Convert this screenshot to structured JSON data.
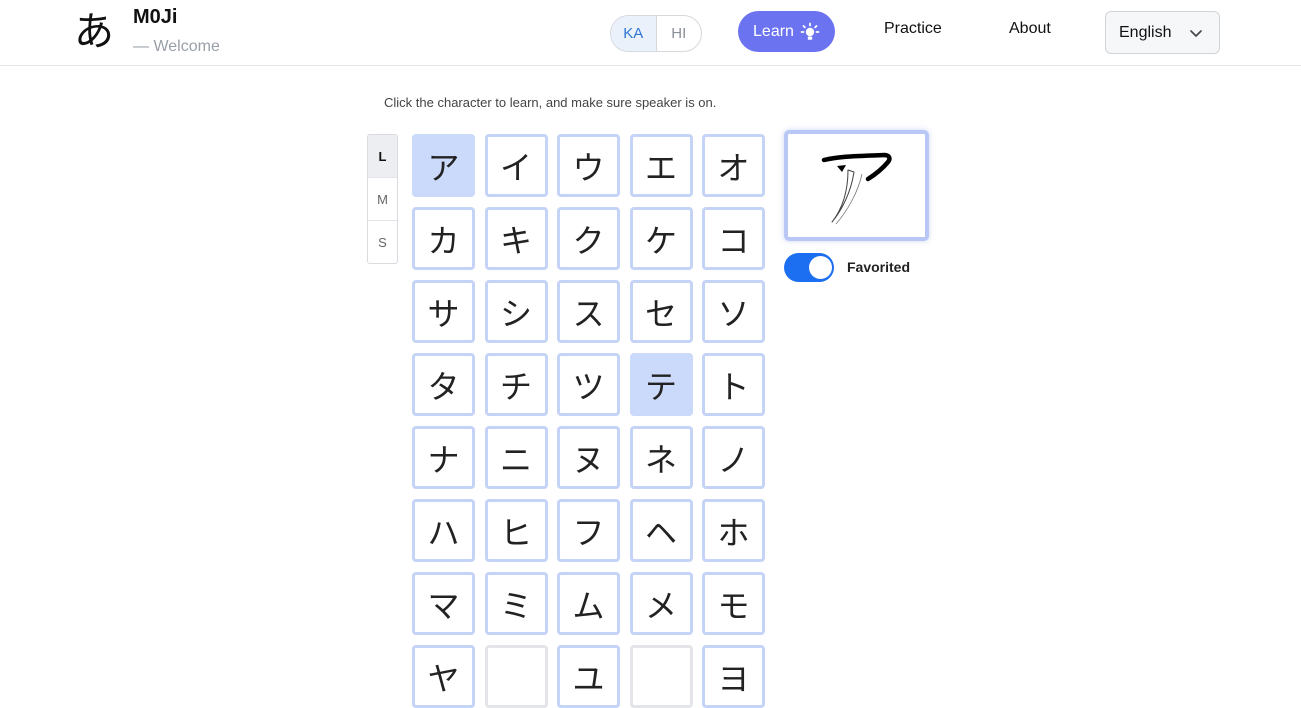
{
  "header": {
    "logo_glyph": "あ",
    "app_title": "M0Ji",
    "subtitle": "— Welcome",
    "script_toggle": [
      {
        "label": "KA",
        "active": true
      },
      {
        "label": "HI",
        "active": false
      }
    ],
    "nav": {
      "learn_label": "Learn",
      "practice_label": "Practice",
      "about_label": "About"
    },
    "language": {
      "selected": "English"
    }
  },
  "main": {
    "hint": "Click the character to learn, and make sure speaker is on.",
    "size_tabs": [
      {
        "label": "L",
        "active": true
      },
      {
        "label": "M",
        "active": false
      },
      {
        "label": "S",
        "active": false
      }
    ],
    "characters": [
      "ア",
      "イ",
      "ウ",
      "エ",
      "オ",
      "カ",
      "キ",
      "ク",
      "ケ",
      "コ",
      "サ",
      "シ",
      "ス",
      "セ",
      "ソ",
      "タ",
      "チ",
      "ツ",
      "テ",
      "ト",
      "ナ",
      "ニ",
      "ヌ",
      "ネ",
      "ノ",
      "ハ",
      "ヒ",
      "フ",
      "ヘ",
      "ホ",
      "マ",
      "ミ",
      "ム",
      "メ",
      "モ",
      "ヤ",
      "",
      "ユ",
      "",
      "ヨ"
    ],
    "selected_characters": [
      "ア",
      "テ"
    ],
    "preview": {
      "character": "ア"
    },
    "favorited": {
      "label": "Favorited",
      "on": true
    }
  },
  "colors": {
    "accent": "#6b73f0",
    "toggle_on": "#1d6ff2",
    "cell_border": "#c5d4f6",
    "cell_selected": "#cbd9fb"
  }
}
